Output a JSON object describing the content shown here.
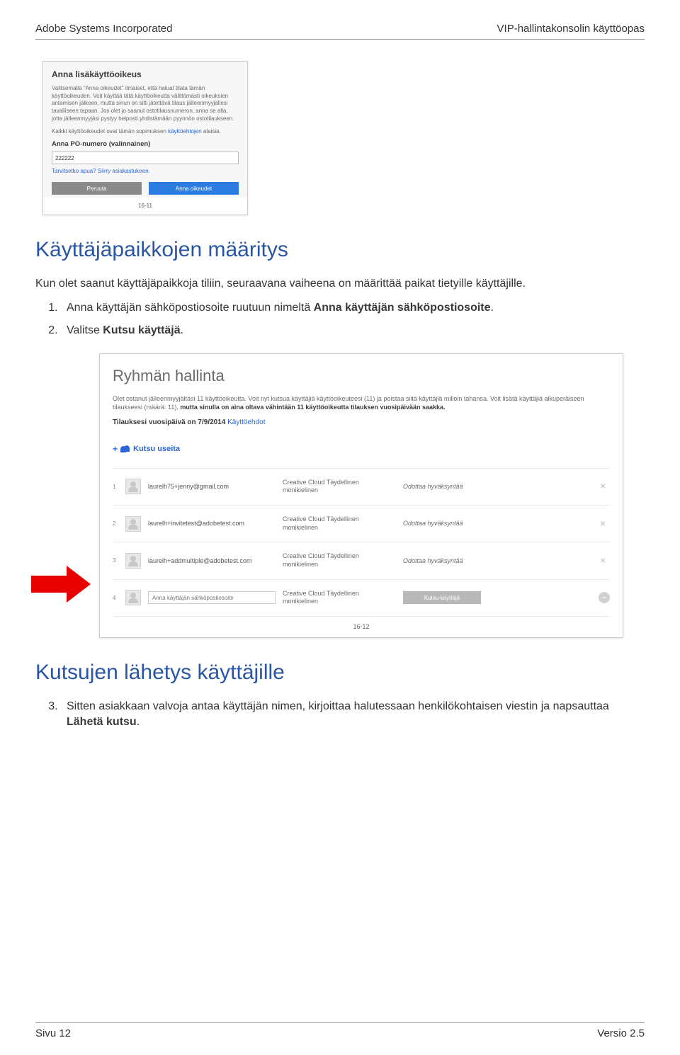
{
  "header": {
    "left": "Adobe Systems Incorporated",
    "right": "VIP-hallintakonsolin käyttöopas"
  },
  "footer": {
    "left": "Sivu 12",
    "right": "Versio 2.5"
  },
  "shot1": {
    "title": "Anna lisäkäyttöoikeus",
    "desc": "Valitsemalla \"Anna oikeudet\" ilmaiset, että haluat tilata tämän käyttöoikeuden. Voit käyttää tätä käyttöoikeutta välittömästi oikeuksien antamisen jälkeen, mutta sinun on silti jätettävä tilaus jälleenmyyjällesi tavalliseen tapaan. Jos olet jo saanut ostotilausnumeron, anna se alla, jotta jälleenmyyjäsi pystyy helposti yhdistämään pyynnön ostotilaukseen.",
    "terms_pre": "Kaikki käyttöoikeudet ovat tämän sopimuksen ",
    "terms_link": "käyttöehtojen",
    "terms_post": " alaisia.",
    "po_label": "Anna PO-numero (valinnainen)",
    "po_value": "222222",
    "help": "Tarvitsetko apua? Siirry asiakastukeen.",
    "cancel": "Peruuta",
    "grant": "Anna oikeudet",
    "fignum": "16-11"
  },
  "section1": {
    "title": "Käyttäjäpaikkojen määritys",
    "intro": "Kun olet saanut käyttäjäpaikkoja tiliin, seuraavana vaiheena on määrittää paikat tietyille käyttäjille.",
    "step1_pre": "Anna käyttäjän sähköpostiosoite ruutuun nimeltä ",
    "step1_bold": "Anna käyttäjän sähköpostiosoite",
    "step1_post": ".",
    "step2_pre": "Valitse ",
    "step2_bold": "Kutsu käyttäjä",
    "step2_post": "."
  },
  "shot2": {
    "title": "Ryhmän hallinta",
    "intro_pre": "Olet ostanut jälleenmyyjältäsi 11 käyttöoikeutta. Voit nyt kutsua käyttäjiä käyttöoikeuteesi (11) ja poistaa siitä käyttäjiä milloin tahansa. Voit lisätä käyttäjiä alkuperäiseen tilaukseesi (määrä: 11), ",
    "intro_bold": "mutta sinulla on aina oltava vähintään 11 käyttöoikeutta tilauksen vuosipäivään saakka.",
    "year_pre": "Tilauksesi vuosipäivä on 7/9/2014 ",
    "year_link": "Käyttöehdot",
    "invite_multi": "Kutsu useita",
    "product_line1": "Creative Cloud Täydellinen",
    "product_line2": "monikielinen",
    "status": "Odottaa hyväksyntää",
    "rows": [
      {
        "num": "1",
        "email": "laurelh75+jenny@gmail.com"
      },
      {
        "num": "2",
        "email": "laurelh+invitetest@adobetest.com"
      },
      {
        "num": "3",
        "email": "laurelh+addmultiple@adobetest.com"
      }
    ],
    "input_row": {
      "num": "4",
      "placeholder": "Anna käyttäjän sähköpostiosoite",
      "button": "Kutsu käyttäjä"
    },
    "fignum": "16-12"
  },
  "section2": {
    "title": "Kutsujen lähetys käyttäjille",
    "step3_pre": "Sitten asiakkaan valvoja antaa käyttäjän nimen, kirjoittaa halutessaan henkilökohtaisen viestin ja napsauttaa ",
    "step3_bold": "Lähetä kutsu",
    "step3_post": "."
  }
}
